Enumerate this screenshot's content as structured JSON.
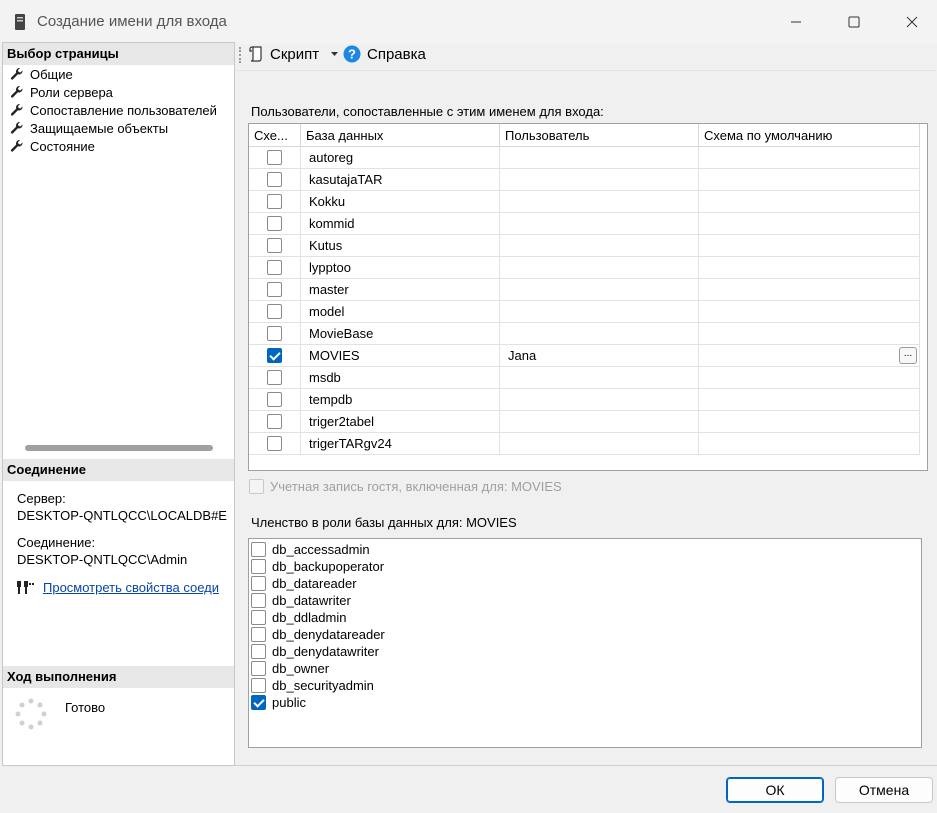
{
  "window": {
    "title": "Создание имени для входа",
    "minimize_icon": "minimize-icon",
    "maximize_icon": "maximize-icon",
    "close_icon": "close-icon"
  },
  "left": {
    "select_page_header": "Выбор страницы",
    "pages": [
      {
        "label": "Общие",
        "icon": "wrench-icon"
      },
      {
        "label": "Роли сервера",
        "icon": "wrench-icon"
      },
      {
        "label": "Сопоставление пользователей",
        "icon": "wrench-icon"
      },
      {
        "label": "Защищаемые объекты",
        "icon": "wrench-icon"
      },
      {
        "label": "Состояние",
        "icon": "wrench-icon"
      }
    ],
    "connection_header": "Соединение",
    "server_label": "Сервер:",
    "server_value": "DESKTOP-QNTLQCC\\LOCALDB#E",
    "connection_label": "Соединение:",
    "connection_value": "DESKTOP-QNTLQCC\\Admin",
    "view_properties_link": "Просмотреть свойства соеди",
    "progress_header": "Ход выполнения",
    "progress_status": "Готово"
  },
  "toolbar": {
    "script_label": "Скрипт",
    "help_label": "Справка"
  },
  "mapping": {
    "section_label": "Пользователи, сопоставленные с этим именем для входа:",
    "columns": [
      "Схе...",
      "База данных",
      "Пользователь",
      "Схема по умолчанию"
    ],
    "rows": [
      {
        "checked": false,
        "database": "autoreg",
        "user": "",
        "schema": ""
      },
      {
        "checked": false,
        "database": "kasutajaTAR",
        "user": "",
        "schema": ""
      },
      {
        "checked": false,
        "database": "Kokku",
        "user": "",
        "schema": ""
      },
      {
        "checked": false,
        "database": "kommid",
        "user": "",
        "schema": ""
      },
      {
        "checked": false,
        "database": "Kutus",
        "user": "",
        "schema": ""
      },
      {
        "checked": false,
        "database": "lypptoo",
        "user": "",
        "schema": ""
      },
      {
        "checked": false,
        "database": "master",
        "user": "",
        "schema": ""
      },
      {
        "checked": false,
        "database": "model",
        "user": "",
        "schema": ""
      },
      {
        "checked": false,
        "database": "MovieBase",
        "user": "",
        "schema": ""
      },
      {
        "checked": true,
        "database": "MOVIES",
        "user": "Jana",
        "schema": "",
        "ellipsis": "..."
      },
      {
        "checked": false,
        "database": "msdb",
        "user": "",
        "schema": ""
      },
      {
        "checked": false,
        "database": "tempdb",
        "user": "",
        "schema": ""
      },
      {
        "checked": false,
        "database": "triger2tabel",
        "user": "",
        "schema": ""
      },
      {
        "checked": false,
        "database": "trigerTARgv24",
        "user": "",
        "schema": ""
      }
    ],
    "guest_label": "Учетная запись гостя, включенная для: MOVIES"
  },
  "roles": {
    "section_label": "Членство в роли базы данных для: MOVIES",
    "items": [
      {
        "label": "db_accessadmin",
        "checked": false
      },
      {
        "label": "db_backupoperator",
        "checked": false
      },
      {
        "label": "db_datareader",
        "checked": false
      },
      {
        "label": "db_datawriter",
        "checked": false
      },
      {
        "label": "db_ddladmin",
        "checked": false
      },
      {
        "label": "db_denydatareader",
        "checked": false
      },
      {
        "label": "db_denydatawriter",
        "checked": false
      },
      {
        "label": "db_owner",
        "checked": false
      },
      {
        "label": "db_securityadmin",
        "checked": false
      },
      {
        "label": "public",
        "checked": true
      }
    ]
  },
  "buttons": {
    "ok": "ОК",
    "cancel": "Отмена"
  },
  "colors": {
    "accent": "#0067c0",
    "link": "#0645ad",
    "help_icon": "#1e88e5"
  }
}
